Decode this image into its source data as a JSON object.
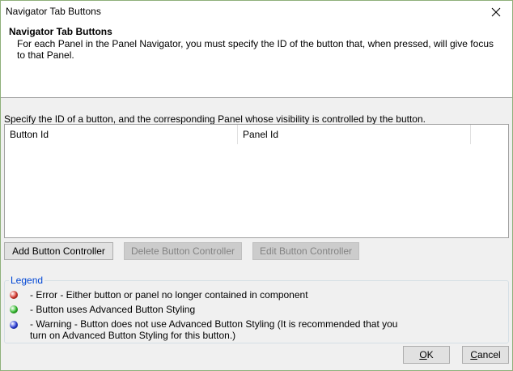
{
  "window": {
    "title": "Navigator Tab Buttons"
  },
  "header": {
    "title": "Navigator Tab Buttons",
    "description": "For each Panel in the Panel Navigator, you must specify the ID of the button that, when pressed, will give focus to that Panel."
  },
  "instruction": "Specify the ID of a button, and the corresponding Panel whose visibility is controlled by the button.",
  "table": {
    "columns": [
      "Button Id",
      "Panel Id",
      ""
    ],
    "rows": []
  },
  "actions": {
    "add_label": "Add Button Controller",
    "delete_label": "Delete Button Controller",
    "edit_label": "Edit Button Controller"
  },
  "legend": {
    "caption": "Legend",
    "items": [
      {
        "color": "#e03a2f",
        "icon": "red-status-dot-icon",
        "text": "- Error - Either button or panel no longer contained in component"
      },
      {
        "color": "#34c32e",
        "icon": "green-status-dot-icon",
        "text": "- Button uses Advanced Button Styling"
      },
      {
        "color": "#2b3fe0",
        "icon": "blue-status-dot-icon",
        "text": "- Warning - Button does not use Advanced Button Styling (It is recommended that you turn on Advanced Button Styling for this button.)"
      }
    ]
  },
  "footer": {
    "ok_prefix": "",
    "ok_mnemonic": "O",
    "ok_suffix": "K",
    "cancel_mnemonic": "C",
    "cancel_suffix": "ancel"
  }
}
